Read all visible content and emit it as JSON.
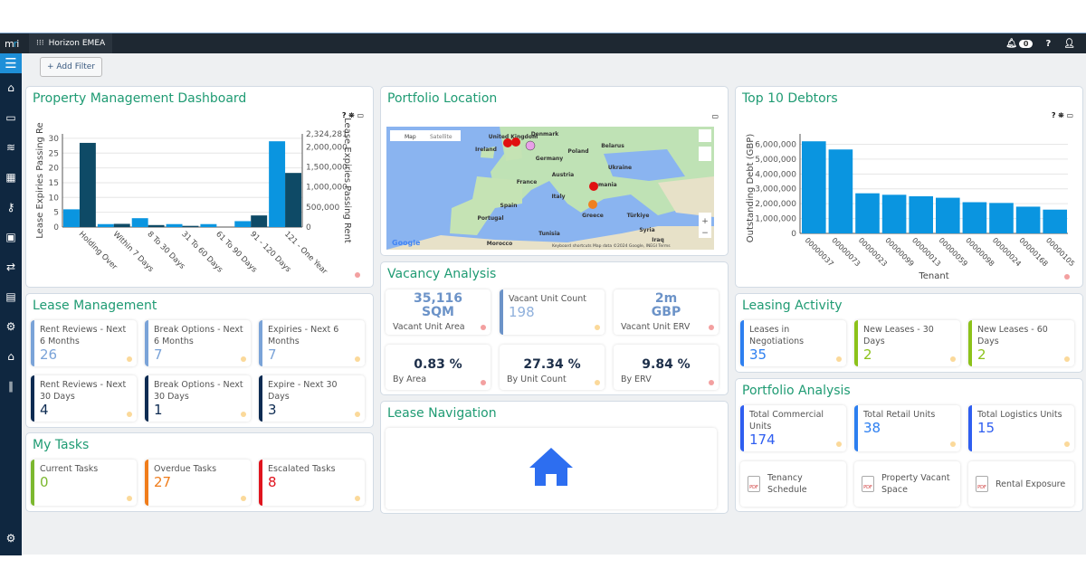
{
  "topbar": {
    "brand": "mri",
    "app_name": "Horizon EMEA",
    "notification_count": "0",
    "help": "?",
    "icons": [
      "bell-icon",
      "help-icon",
      "user-icon"
    ]
  },
  "sidebar": {
    "items": [
      "home-icon",
      "monitor-icon",
      "database-icon",
      "building-icon",
      "key-icon",
      "gl-icon",
      "transfer-icon",
      "document-icon",
      "settings-icon",
      "house-icon",
      "library-icon",
      "user-settings-icon"
    ]
  },
  "filter": {
    "add_filter": "Add Filter"
  },
  "pmd": {
    "title": "Property Management Dashboard",
    "controls": "? ⛯ ▭"
  },
  "location": {
    "title": "Portfolio Location",
    "map_tab": "Map",
    "satellite_tab": "Satellite",
    "labels": [
      "Denmark",
      "United Kingdom",
      "Ireland",
      "Belarus",
      "Poland",
      "Germany",
      "Ukraine",
      "Austria",
      "France",
      "Romania",
      "Italy",
      "Spain",
      "Portugal",
      "Greece",
      "Türkiye",
      "Tunisia",
      "Morocco",
      "Syria",
      "Iraq"
    ],
    "attribution": "Keyboard shortcuts   Map data ©2024 Google, INEGI   Terms",
    "google": "Google"
  },
  "debtors": {
    "title": "Top 10 Debtors"
  },
  "lease_mgmt": {
    "title": "Lease Management",
    "cards": [
      {
        "label": "Rent Reviews - Next 6 Months",
        "value": "26",
        "color": "#7aa3d8"
      },
      {
        "label": "Break Options - Next 6 Months",
        "value": "7",
        "color": "#7aa3d8"
      },
      {
        "label": "Expiries - Next 6 Months",
        "value": "7",
        "color": "#7aa3d8"
      },
      {
        "label": "Rent Reviews - Next 30 Days",
        "value": "4",
        "color": "#0d2b52"
      },
      {
        "label": "Break Options - Next 30 Days",
        "value": "1",
        "color": "#0d2b52"
      },
      {
        "label": "Expire - Next 30 Days",
        "value": "3",
        "color": "#0d2b52"
      }
    ]
  },
  "tasks": {
    "title": "My Tasks",
    "cards": [
      {
        "label": "Current Tasks",
        "value": "0",
        "color": "#7cb82f"
      },
      {
        "label": "Overdue Tasks",
        "value": "27",
        "color": "#f07d1b"
      },
      {
        "label": "Escalated Tasks",
        "value": "8",
        "color": "#e0141e"
      }
    ]
  },
  "vacancy": {
    "title": "Vacancy Analysis",
    "area": {
      "value": "35,116",
      "unit": "SQM",
      "label": "Vacant Unit Area"
    },
    "count": {
      "label": "Vacant Unit Count",
      "value": "198"
    },
    "erv": {
      "value": "2m",
      "unit": "GBP",
      "label": "Vacant Unit ERV"
    },
    "by_area": {
      "value": "0.83 %",
      "label": "By Area"
    },
    "by_count": {
      "value": "27.34 %",
      "label": "By Unit Count"
    },
    "by_erv": {
      "value": "9.84 %",
      "label": "By ERV"
    }
  },
  "lease_nav": {
    "title": "Lease Navigation",
    "icon": "home-icon",
    "color": "#2d6ef0"
  },
  "leasing": {
    "title": "Leasing Activity",
    "cards": [
      {
        "label": "Leases in Negotiations",
        "value": "35",
        "color": "#2d7ff0"
      },
      {
        "label": "New Leases - 30 Days",
        "value": "2",
        "color": "#8cc21a"
      },
      {
        "label": "New Leases - 60 Days",
        "value": "2",
        "color": "#8cc21a"
      }
    ]
  },
  "portfolio": {
    "title": "Portfolio Analysis",
    "cards": [
      {
        "label": "Total Commercial Units",
        "value": "174",
        "color": "#2f5ef0"
      },
      {
        "label": "Total Retail Units",
        "value": "38",
        "color": "#2d7ff0"
      },
      {
        "label": "Total Logistics Units",
        "value": "15",
        "color": "#2f5ef0"
      }
    ],
    "reports": [
      "Tenancy Schedule",
      "Property Vacant Space",
      "Rental Exposure"
    ],
    "pdf": "PDF"
  },
  "chart_data": [
    {
      "type": "bar",
      "categories": [
        "Holding Over",
        "Within 7 Days",
        "8 To 30 Days",
        "31 To 60 Days",
        "61 To 90 Days",
        "91 - 120 Days",
        "121 - One Year"
      ],
      "ylabel": "Lease Expiries Passing Re",
      "y2label": "Lease Expiries Passing Rent",
      "yticks": [
        "0",
        "5",
        "10",
        "15",
        "20",
        "25",
        "30"
      ],
      "y2ticks": [
        "0",
        "500,000",
        "1,000,000",
        "1,500,000",
        "2,000,000",
        "2,324,281"
      ],
      "ylim": [
        0,
        31.5
      ],
      "y2lim": [
        0,
        2324281
      ],
      "grid": true,
      "series": [
        {
          "axis": "left",
          "color": "#0a95e0",
          "values": [
            6,
            1,
            3,
            1,
            1,
            2,
            29
          ]
        },
        {
          "axis": "right",
          "color": "#0e4a66",
          "values": [
            2100000,
            80000,
            50000,
            30000,
            0,
            290000,
            1350000
          ]
        }
      ]
    },
    {
      "type": "bar",
      "title": "",
      "xlabel": "Tenant",
      "ylabel": "Outstanding Debt (GBP)",
      "categories": [
        "00000037",
        "00000073",
        "00000023",
        "00000099",
        "00000013",
        "00000059",
        "00000098",
        "00000024",
        "00000168",
        "00000105"
      ],
      "values": [
        6200000,
        5650000,
        2700000,
        2600000,
        2500000,
        2400000,
        2100000,
        2050000,
        1800000,
        1600000
      ],
      "yticks": [
        "0",
        "1,000,000",
        "2,000,000",
        "3,000,000",
        "4,000,000",
        "5,000,000",
        "6,000,000"
      ],
      "ylim": [
        0,
        6700000
      ],
      "grid": true,
      "color": "#0a95e0"
    }
  ]
}
